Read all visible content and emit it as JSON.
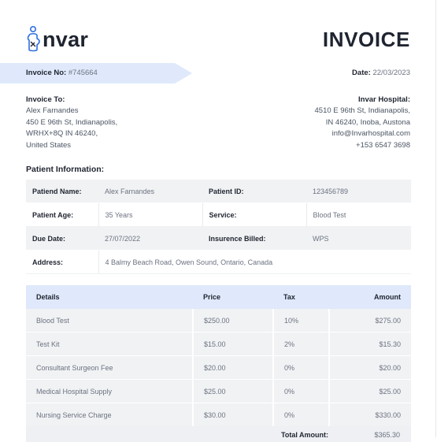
{
  "brand": {
    "name": "nvar",
    "logo_icon": "person-i-logo-icon"
  },
  "title": "INVOICE",
  "invoice": {
    "no_label": "Invoice No:",
    "no_value": "#745664",
    "date_label": "Date:",
    "date_value": "22/03/2023"
  },
  "bill_to": {
    "heading": "Invoice To:",
    "lines": [
      "Alex Farnandes",
      "450 E 96th St, Indianapolis,",
      "WRHX+8Q IN 46240,",
      "United States"
    ]
  },
  "hospital": {
    "heading": "Invar Hospital:",
    "lines": [
      "4510 E 96th St, Indianapolis,",
      "IN 46240, Inoba, Austona",
      "info@Invarhospital.com",
      "+153 6547 3698"
    ]
  },
  "patient_section": "Patient Information:",
  "patient": {
    "name_label": "Patiend Name:",
    "name": "Alex Farnandes",
    "id_label": "Patient ID:",
    "id": "123456789",
    "age_label": "Patient Age:",
    "age": "35 Years",
    "service_label": "Service:",
    "service": "Blood Test",
    "due_label": "Due Date:",
    "due": "27/07/2022",
    "insurance_label": "Insurence Billed:",
    "insurance": "WPS",
    "address_label": "Address:",
    "address": "4 Balmy Beach Road, Owen Sound, Ontario, Canada"
  },
  "items": {
    "headers": [
      "Details",
      "Price",
      "Tax",
      "Amount"
    ],
    "rows": [
      [
        "Blood Test",
        "$250.00",
        "10%",
        "$275.00"
      ],
      [
        "Test Kit",
        "$15.00",
        "2%",
        "$15.30"
      ],
      [
        "Consultant Surgeon Fee",
        "$20.00",
        "0%",
        "$20.00"
      ],
      [
        "Medical Hospital Supply",
        "$25.00",
        "0%",
        "$25.00"
      ],
      [
        "Nursing Service Charge",
        "$30.00",
        "0%",
        "$330.00"
      ]
    ]
  },
  "total": {
    "label": "Total Amount:",
    "value": "$365.30"
  },
  "colors": {
    "ribbon": "#dfe9fb",
    "header_row": "#dfe9fb",
    "shade": "#f1f2f4",
    "logo_blue": "#2f6fe0"
  }
}
